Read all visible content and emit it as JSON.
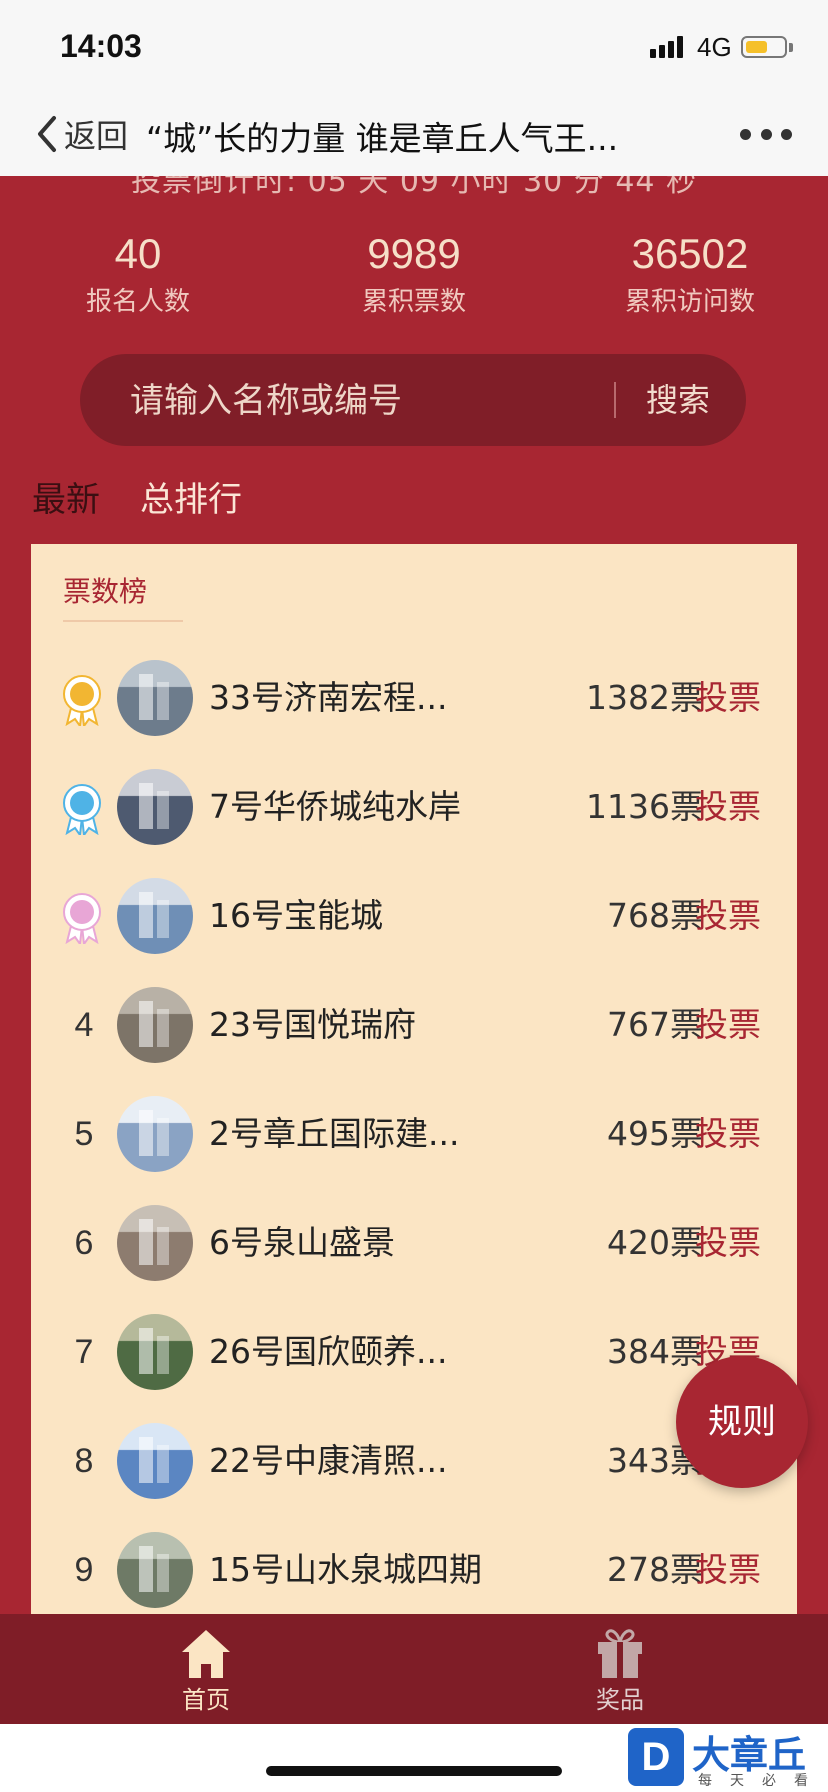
{
  "status_bar": {
    "time": "14:03",
    "network": "4G",
    "battery_level": 0.55,
    "battery_color": "#f5c02a"
  },
  "nav": {
    "back_label": "返回",
    "title": "“城”长的力量 谁是章丘人气王...",
    "more_icon": "more-dots-icon"
  },
  "countdown": "投票倒计时: 05 天 09 小时 30 分 44 秒",
  "stats": [
    {
      "value": "40",
      "label": "报名人数"
    },
    {
      "value": "9989",
      "label": "累积票数"
    },
    {
      "value": "36502",
      "label": "累积访问数"
    }
  ],
  "search": {
    "placeholder": "请输入名称或编号",
    "button": "搜索"
  },
  "tabs": [
    {
      "label": "最新",
      "active": true
    },
    {
      "label": "总排行",
      "active": false
    }
  ],
  "board": {
    "title": "票数榜",
    "vote_label": "投票",
    "rows": [
      {
        "rank": "1",
        "medal": "gold",
        "name": "33号济南宏程...",
        "votes": "1382票"
      },
      {
        "rank": "2",
        "medal": "blue",
        "name": "7号华侨城纯水岸",
        "votes": "1136票"
      },
      {
        "rank": "3",
        "medal": "pink",
        "name": "16号宝能城",
        "votes": "768票"
      },
      {
        "rank": "4",
        "name": "23号国悦瑞府",
        "votes": "767票"
      },
      {
        "rank": "5",
        "name": "2号章丘国际建...",
        "votes": "495票"
      },
      {
        "rank": "6",
        "name": "6号泉山盛景",
        "votes": "420票"
      },
      {
        "rank": "7",
        "name": "26号国欣颐养...",
        "votes": "384票"
      },
      {
        "rank": "8",
        "name": "22号中康清照...",
        "votes": "343票"
      },
      {
        "rank": "9",
        "name": "15号山水泉城四期",
        "votes": "278票"
      }
    ]
  },
  "rules_button": "规则",
  "tabbar": [
    {
      "label": "首页",
      "icon": "home-icon",
      "active": true
    },
    {
      "label": "奖品",
      "icon": "gift-icon",
      "active": false
    }
  ],
  "watermark": {
    "title": "大章丘",
    "subtitle": "每天必看",
    "logo_letter": "D"
  },
  "colors": {
    "primary_red": "#a82632",
    "dark_red": "#7f1d27",
    "board_bg": "#fbe5c4",
    "gold": "#f2b632",
    "blue": "#4fb3e6",
    "pink": "#e8a6d6"
  }
}
